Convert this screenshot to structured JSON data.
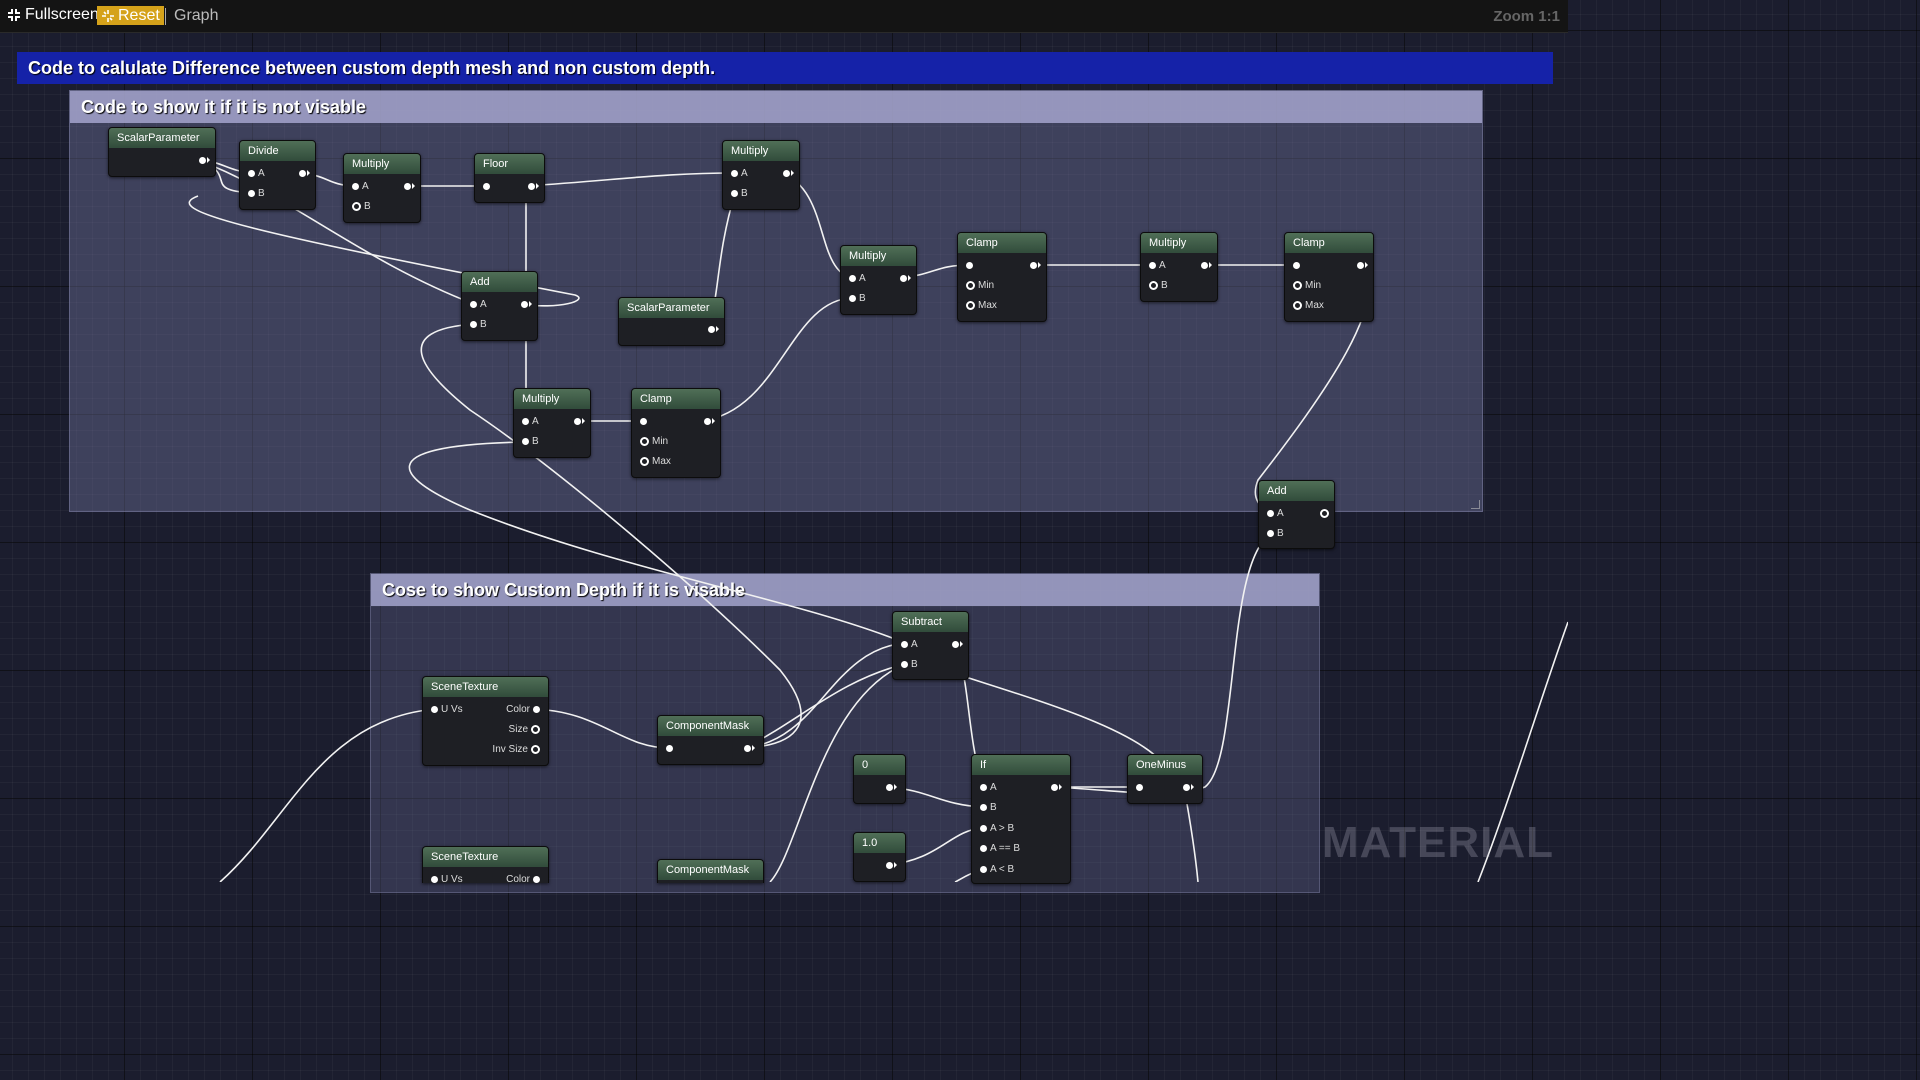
{
  "toolbar": {
    "fullscreen_label": "Fullscreen",
    "reset_label": "Reset",
    "graph_label": "Graph",
    "zoom_label": "Zoom 1:1"
  },
  "comments": {
    "main": "Code to calulate Difference between custom depth mesh and non custom depth.",
    "not_visible": "Code to show it if it is not visable",
    "custom_depth": "Cose to show Custom Depth if it is visable"
  },
  "nodes": {
    "scalar1": "ScalarParameter",
    "divide": "Divide",
    "multiply1": "Multiply",
    "floor": "Floor",
    "multiply2": "Multiply",
    "add1": "Add",
    "scalar2": "ScalarParameter",
    "multiply3": "Multiply",
    "clamp1": "Clamp",
    "multiply4": "Multiply",
    "clamp2": "Clamp",
    "multiply5": "Multiply",
    "clamp3": "Clamp",
    "add2": "Add",
    "subtract": "Subtract",
    "scenetex1": "SceneTexture",
    "compmask1": "ComponentMask",
    "const0": "0",
    "const1": "1.0",
    "if": "If",
    "oneminus": "OneMinus",
    "scenetex2": "SceneTexture",
    "compmask2": "ComponentMask"
  },
  "pins": {
    "a": "A",
    "b": "B",
    "min": "Min",
    "max": "Max",
    "uvs": "U Vs",
    "color": "Color",
    "size": "Size",
    "inv_size": "Inv Size",
    "a_gt_b": "A > B",
    "a_eq_b": "A == B",
    "a_lt_b": "A < B"
  },
  "watermark": "MATERIAL",
  "colors": {
    "toolbar_bg": "#141414",
    "reset_bg": "#d5a21a",
    "main_comment_bg": "#1522a8",
    "node_header": "#314c3b",
    "wire": "#f2f2f2"
  }
}
